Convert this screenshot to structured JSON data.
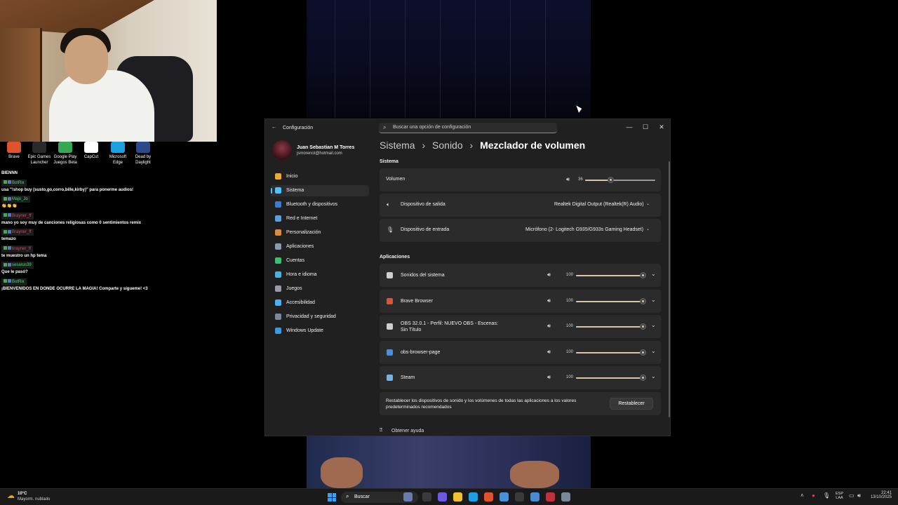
{
  "desktop_icons": [
    {
      "label": "Brave",
      "color": "#e0522b"
    },
    {
      "label": "Epic Games Launcher",
      "color": "#2a2a2a"
    },
    {
      "label": "Google Play Juegos Beta",
      "color": "#34a853"
    },
    {
      "label": "CapCut",
      "color": "#ffffff"
    },
    {
      "label": "Microsoft Edge",
      "color": "#1ba1e2"
    },
    {
      "label": "Dead by Daylight",
      "color": "#2a4a8a"
    }
  ],
  "chat": {
    "first_line": "BIENNN",
    "messages": [
      {
        "user": "BotRix",
        "user_color": "#43e07a",
        "text": "usa \"!shop buy (susto,go,corro,bille,kirby)\" para ponerme audios!"
      },
      {
        "user": "Majo_Jo",
        "user_color": "#43e07a",
        "text": "👏👏👏"
      },
      {
        "user": "Brayner_ff",
        "user_color": "#e04050",
        "text": "mano yo soy muy de canciones religiosas como 0 sentimientos remix"
      },
      {
        "user": "Brayner_ff",
        "user_color": "#e04050",
        "text": "temazo"
      },
      {
        "user": "brayner_ff",
        "user_color": "#e04050",
        "text": "te muestro un hp tema"
      },
      {
        "user": "sesarus39",
        "user_color": "#43e07a",
        "text": "Que le pasó?"
      },
      {
        "user": "BotRix",
        "user_color": "#43e07a",
        "text": "¡BIENVENIDOS EN DONDE OCURRE LA MAGIA! Comparte y sígueme! <3"
      }
    ]
  },
  "window": {
    "title": "Configuración",
    "search_placeholder": "Buscar una opción de configuración",
    "minimize": "—",
    "maximize": "☐",
    "close": "✕"
  },
  "profile": {
    "name": "Juan Sebastian M Torres",
    "email": "jsmorenot@hotmail.com"
  },
  "nav": {
    "items": [
      {
        "label": "Inicio",
        "color": "#f0a830"
      },
      {
        "label": "Sistema",
        "color": "#4cc2ff",
        "active": true
      },
      {
        "label": "Bluetooth y dispositivos",
        "color": "#3a7bd5"
      },
      {
        "label": "Red e Internet",
        "color": "#5aa0e0"
      },
      {
        "label": "Personalización",
        "color": "#e08a40"
      },
      {
        "label": "Aplicaciones",
        "color": "#8a9ab0"
      },
      {
        "label": "Cuentas",
        "color": "#3ac070"
      },
      {
        "label": "Hora e idioma",
        "color": "#4ab0e0"
      },
      {
        "label": "Juegos",
        "color": "#9a9aa8"
      },
      {
        "label": "Accesibilidad",
        "color": "#4ab0f0"
      },
      {
        "label": "Privacidad y seguridad",
        "color": "#7a8898"
      },
      {
        "label": "Windows Update",
        "color": "#3a9ae0"
      }
    ]
  },
  "breadcrumb": {
    "part1": "Sistema",
    "sep": "›",
    "part2": "Sonido",
    "current": "Mezclador de volumen"
  },
  "system_section": {
    "title": "Sistema",
    "volume_label": "Volumen",
    "volume_value": "36",
    "volume_level": 0.36,
    "output_label": "Dispositivo de salida",
    "output_value": "Realtek Digital Output (Realtek(R) Audio)",
    "input_label": "Dispositivo de entrada",
    "input_value": "Micrófono (2- Logitech G935/G933s Gaming Headset)"
  },
  "apps_section": {
    "title": "Aplicaciones",
    "apps": [
      {
        "name": "Sonidos del sistema",
        "volume": "100",
        "icon_color": "#cfcfcf"
      },
      {
        "name": "Brave Browser",
        "volume": "100",
        "icon_color": "#e0522b"
      },
      {
        "name": "OBS 32.0.1 - Perfil: NUEVO OBS - Escenas: Sin Título",
        "volume": "100",
        "icon_color": "#cfcfcf"
      },
      {
        "name": "obs-browser-page",
        "volume": "100",
        "icon_color": "#4a90d9"
      },
      {
        "name": "Steam",
        "volume": "100",
        "icon_color": "#7ab0e0"
      }
    ]
  },
  "reset": {
    "text": "Restablecer los dispositivos de sonido y los volúmenes de todas las aplicaciones a los valores predeterminados recomendados",
    "button": "Restablecer"
  },
  "help": {
    "label": "Obtener ayuda"
  },
  "taskbar": {
    "weather_temp": "10°C",
    "weather_desc": "Mayorm. nublado",
    "search": "Buscar",
    "lang_top": "ESP",
    "lang_bottom": "LAA",
    "time": "22:41",
    "date": "13/10/2025"
  }
}
